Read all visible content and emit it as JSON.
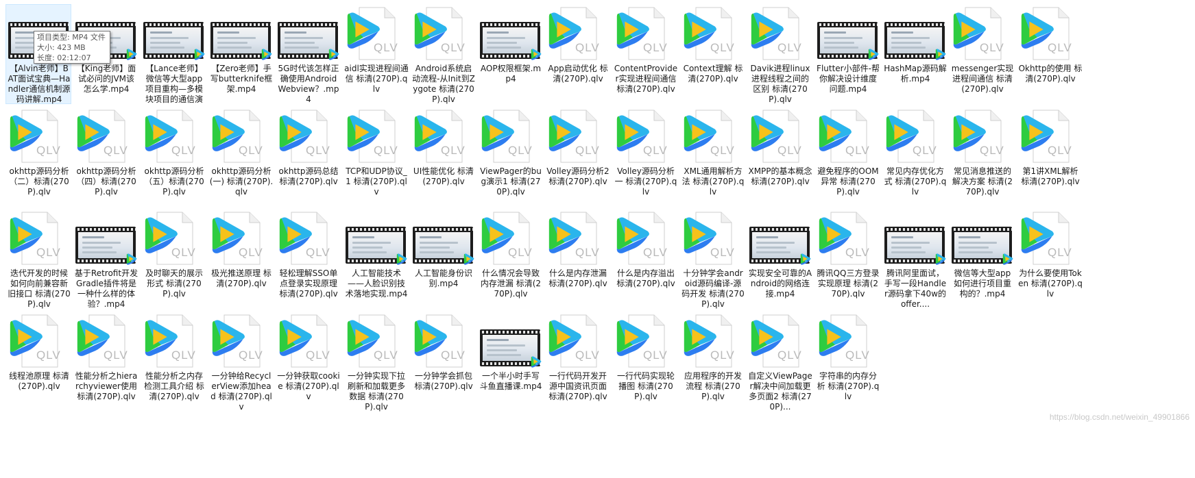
{
  "tooltip": {
    "type_line": "项目类型: MP4 文件",
    "size_line": "大小: 423 MB",
    "duration_line": "长度: 02:12:07"
  },
  "watermark": "https://blog.csdn.net/weixin_49901866",
  "icons": {
    "qlv_text": "QLV",
    "player_colors": [
      "#2ecc40",
      "#2ab5ec",
      "#2d7df0",
      "#f6c21b"
    ]
  },
  "rows": [
    [
      {
        "name": "【Alvin老师】BAT面试宝典—Handler通信机制源码讲解.mp4",
        "kind": "mp4",
        "selected": true
      },
      {
        "name": "【King老师】面试必问的JVM该怎么学.mp4",
        "kind": "mp4"
      },
      {
        "name": "【Lance老师】微信等大型app项目重构—多模块项目的通信演变...",
        "kind": "mp4"
      },
      {
        "name": "【Zero老师】手写butterknife框架.mp4",
        "kind": "mp4"
      },
      {
        "name": "5G时代该怎样正确使用Android Webview？.mp4",
        "kind": "mp4"
      },
      {
        "name": "aidl实现进程间通信 标清(270P).qlv",
        "kind": "qlv"
      },
      {
        "name": "Android系统启动流程-从Init到Zygote 标清(270P).qlv",
        "kind": "qlv"
      },
      {
        "name": "AOP权限框架.mp4",
        "kind": "mp4"
      },
      {
        "name": "App启动优化 标清(270P).qlv",
        "kind": "qlv"
      },
      {
        "name": "ContentProvider实现进程间通信 标清(270P).qlv",
        "kind": "qlv"
      },
      {
        "name": "Context理解 标清(270P).qlv",
        "kind": "qlv"
      },
      {
        "name": "Davik进程linux进程线程之间的区别 标清(270P).qlv",
        "kind": "qlv"
      },
      {
        "name": "Flutter小部件-帮你解决设计维度问题.mp4",
        "kind": "mp4"
      },
      {
        "name": "HashMap源码解析.mp4",
        "kind": "mp4"
      },
      {
        "name": "messenger实现进程间通信 标清(270P).qlv",
        "kind": "qlv"
      },
      {
        "name": "Okhttp的使用 标清(270P).qlv",
        "kind": "qlv"
      }
    ],
    [
      {
        "name": "okhttp源码分析（二）标清(270P).qlv",
        "kind": "qlv"
      },
      {
        "name": "okhttp源码分析（四）标清(270P).qlv",
        "kind": "qlv"
      },
      {
        "name": "okhttp源码分析（五）标清(270P).qlv",
        "kind": "qlv"
      },
      {
        "name": "okhttp源码分析(一) 标清(270P).qlv",
        "kind": "qlv"
      },
      {
        "name": "okhttp源码总结 标清(270P).qlv",
        "kind": "qlv"
      },
      {
        "name": "TCP和UDP协议_1 标清(270P).qlv",
        "kind": "qlv"
      },
      {
        "name": "UI性能优化 标清(270P).qlv",
        "kind": "qlv"
      },
      {
        "name": "ViewPager的bug演示1 标清(270P).qlv",
        "kind": "qlv"
      },
      {
        "name": "Volley源码分析2 标清(270P).qlv",
        "kind": "qlv"
      },
      {
        "name": "Volley源码分析一 标清(270P).qlv",
        "kind": "qlv"
      },
      {
        "name": "XML通用解析方法 标清(270P).qlv",
        "kind": "qlv"
      },
      {
        "name": "XMPP的基本概念 标清(270P).qlv",
        "kind": "qlv"
      },
      {
        "name": "避免程序的OOM异常 标清(270P).qlv",
        "kind": "qlv"
      },
      {
        "name": "常见内存优化方式 标清(270P).qlv",
        "kind": "qlv"
      },
      {
        "name": "常见消息推送的解决方案 标清(270P).qlv",
        "kind": "qlv"
      },
      {
        "name": "第1讲XML解析 标清(270P).qlv",
        "kind": "qlv"
      }
    ],
    [
      {
        "name": "迭代开发的时候如何向前兼容新旧接口 标清(270P).qlv",
        "kind": "qlv"
      },
      {
        "name": "基于Retrofit开发Gradle插件将是一种什么样的体验？.mp4",
        "kind": "mp4"
      },
      {
        "name": "及时聊天的展示形式 标清(270P).qlv",
        "kind": "qlv"
      },
      {
        "name": "极光推送原理 标清(270P).qlv",
        "kind": "qlv"
      },
      {
        "name": "轻松理解SSO单点登录实现原理 标清(270P).qlv",
        "kind": "qlv"
      },
      {
        "name": "人工智能技术——人脸识别技术落地实现.mp4",
        "kind": "mp4"
      },
      {
        "name": "人工智能身份识别.mp4",
        "kind": "mp4"
      },
      {
        "name": "什么情况会导致内存泄漏 标清(270P).qlv",
        "kind": "qlv"
      },
      {
        "name": "什么是内存泄漏 标清(270P).qlv",
        "kind": "qlv"
      },
      {
        "name": "什么是内存溢出 标清(270P).qlv",
        "kind": "qlv"
      },
      {
        "name": "十分钟学会android源码编译-源码开发 标清(270P).qlv",
        "kind": "qlv"
      },
      {
        "name": "实现安全可靠的Android的网络连接.mp4",
        "kind": "mp4"
      },
      {
        "name": "腾讯QQ三方登录实现原理 标清(270P).qlv",
        "kind": "qlv"
      },
      {
        "name": "腾讯阿里面试，手写一段Handler源码拿下40w的offer....",
        "kind": "mp4"
      },
      {
        "name": "微信等大型app如何进行项目重构的？.mp4",
        "kind": "mp4"
      },
      {
        "name": "为什么要使用Token 标清(270P).qlv",
        "kind": "qlv"
      }
    ],
    [
      {
        "name": "线程池原理 标清(270P).qlv",
        "kind": "qlv"
      },
      {
        "name": "性能分析之hierarchyviewer使用 标清(270P).qlv",
        "kind": "qlv"
      },
      {
        "name": "性能分析之内存检测工具介绍 标清(270P).qlv",
        "kind": "qlv"
      },
      {
        "name": "一分钟给RecyclerView添加head 标清(270P).qlv",
        "kind": "qlv"
      },
      {
        "name": "一分钟获取cookie 标清(270P).qlv",
        "kind": "qlv"
      },
      {
        "name": "一分钟实现下拉刷新和加载更多数据 标清(270P).qlv",
        "kind": "qlv"
      },
      {
        "name": "一分钟学会抓包 标清(270P).qlv",
        "kind": "qlv"
      },
      {
        "name": "一个半小时手写斗鱼直播课.mp4",
        "kind": "mp4"
      },
      {
        "name": "一行代码开发开源中国资讯页面 标清(270P).qlv",
        "kind": "qlv"
      },
      {
        "name": "一行代码实现轮播图 标清(270P).qlv",
        "kind": "qlv"
      },
      {
        "name": "应用程序的开发流程 标清(270P).qlv",
        "kind": "qlv"
      },
      {
        "name": "自定义ViewPager解决中间加载更多页面2 标清(270P)...",
        "kind": "qlv"
      },
      {
        "name": "字符串的内存分析 标清(270P).qlv",
        "kind": "qlv"
      }
    ]
  ]
}
